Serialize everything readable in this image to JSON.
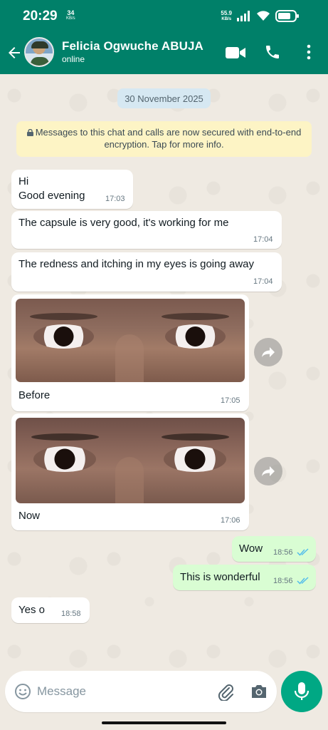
{
  "status_bar": {
    "time": "20:29",
    "speed_value": "34",
    "speed_unit": "KB/s",
    "net_value": "55.9",
    "net_unit": "KB/s",
    "signal_icon": "signal-icon",
    "wifi_icon": "wifi-icon",
    "battery_icon": "battery-icon"
  },
  "header": {
    "contact_name": "Felicia Ogwuche ABUJA",
    "status": "online",
    "icons": [
      "back-arrow-icon",
      "video-call-icon",
      "voice-call-icon",
      "more-options-icon"
    ]
  },
  "chat": {
    "date_chip": "30 November 2025",
    "encryption_notice": "Messages to this chat and calls are now secured with end-to-end encryption. Tap for more info.",
    "messages": [
      {
        "direction": "in",
        "lines": [
          "Hi",
          "Good evening"
        ],
        "time": "17:03"
      },
      {
        "direction": "in",
        "text": "The capsule is very good, it's working for me",
        "time": "17:04"
      },
      {
        "direction": "in",
        "text": "The redness and itching in my eyes is going away",
        "time": "17:04"
      },
      {
        "direction": "in",
        "type": "image",
        "caption": "Before",
        "time": "17:05"
      },
      {
        "direction": "in",
        "type": "image",
        "caption": "Now",
        "time": "17:06"
      },
      {
        "direction": "out",
        "text": "Wow",
        "time": "18:56",
        "status": "read"
      },
      {
        "direction": "out",
        "text": "This is wonderful",
        "time": "18:56",
        "status": "read"
      },
      {
        "direction": "in",
        "text": "Yes o",
        "time": "18:58"
      }
    ]
  },
  "composer": {
    "placeholder": "Message",
    "icons": [
      "emoji-icon",
      "attach-icon",
      "camera-icon",
      "mic-icon"
    ]
  },
  "colors": {
    "header": "#008069",
    "outgoing_bubble": "#d9fdd3",
    "accent": "#00a884",
    "read_ticks": "#53bdeb"
  }
}
